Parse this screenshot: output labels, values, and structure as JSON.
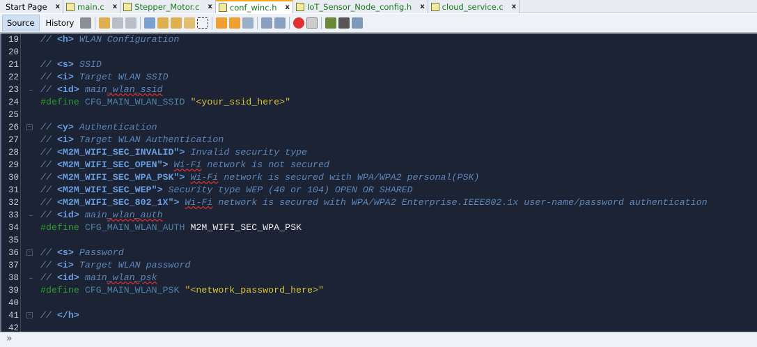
{
  "tabs": [
    {
      "label": "Start Page",
      "active": false
    },
    {
      "label": "main.c",
      "active": false
    },
    {
      "label": "Stepper_Motor.c",
      "active": false
    },
    {
      "label": "conf_winc.h",
      "active": true
    },
    {
      "label": "IoT_Sensor_Node_config.h",
      "active": false
    },
    {
      "label": "cloud_service.c",
      "active": false
    }
  ],
  "close_glyph": "x",
  "toolbar": {
    "source": "Source",
    "history": "History"
  },
  "editor": {
    "lines": [
      {
        "n": "19",
        "parts": [
          [
            "c",
            "// "
          ],
          [
            "t",
            "<h>"
          ],
          [
            "c",
            " WLAN Configuration"
          ]
        ]
      },
      {
        "n": "20",
        "parts": []
      },
      {
        "n": "21",
        "parts": [
          [
            "c",
            "// "
          ],
          [
            "t",
            "<s>"
          ],
          [
            "c",
            " SSID"
          ]
        ]
      },
      {
        "n": "22",
        "parts": [
          [
            "c",
            "// "
          ],
          [
            "t",
            "<i>"
          ],
          [
            "c",
            " Target WLAN SSID"
          ]
        ]
      },
      {
        "n": "23",
        "fold": "end",
        "parts": [
          [
            "c",
            "// "
          ],
          [
            "t",
            "<id>"
          ],
          [
            "c",
            " main"
          ],
          [
            "q",
            "_wlan_ssid"
          ]
        ]
      },
      {
        "n": "24",
        "parts": [
          [
            "k",
            "#define"
          ],
          [
            "i",
            " CFG_MAIN_WLAN_SSID "
          ],
          [
            "s",
            "\"<your_ssid_here>\""
          ]
        ]
      },
      {
        "n": "25",
        "parts": []
      },
      {
        "n": "26",
        "fold": "box",
        "parts": [
          [
            "c",
            "// "
          ],
          [
            "t",
            "<y>"
          ],
          [
            "c",
            " Authentication"
          ]
        ]
      },
      {
        "n": "27",
        "parts": [
          [
            "c",
            "// "
          ],
          [
            "t",
            "<i>"
          ],
          [
            "c",
            " Target WLAN Authentication"
          ]
        ]
      },
      {
        "n": "28",
        "parts": [
          [
            "c",
            "// "
          ],
          [
            "t",
            "<M2M_WIFI_SEC_INVALID\">"
          ],
          [
            "c",
            " Invalid security type"
          ]
        ]
      },
      {
        "n": "29",
        "parts": [
          [
            "c",
            "// "
          ],
          [
            "t",
            "<M2M_WIFI_SEC_OPEN\">"
          ],
          [
            "c",
            " "
          ],
          [
            "q",
            "Wi-Fi"
          ],
          [
            "c",
            " network is not secured"
          ]
        ]
      },
      {
        "n": "30",
        "parts": [
          [
            "c",
            "// "
          ],
          [
            "t",
            "<M2M_WIFI_SEC_WPA_PSK\">"
          ],
          [
            "c",
            " "
          ],
          [
            "q",
            "Wi-Fi"
          ],
          [
            "c",
            " network is secured with WPA/WPA2 personal(PSK)"
          ]
        ]
      },
      {
        "n": "31",
        "parts": [
          [
            "c",
            "// "
          ],
          [
            "t",
            "<M2M_WIFI_SEC_WEP\">"
          ],
          [
            "c",
            " Security type WEP (40 or 104) OPEN OR SHARED"
          ]
        ]
      },
      {
        "n": "32",
        "parts": [
          [
            "c",
            "// "
          ],
          [
            "t",
            "<M2M_WIFI_SEC_802_1X\">"
          ],
          [
            "c",
            " "
          ],
          [
            "q",
            "Wi-Fi"
          ],
          [
            "c",
            " network is secured with WPA/WPA2 Enterprise.IEEE802.1x user-name/password authentication"
          ]
        ]
      },
      {
        "n": "33",
        "fold": "end",
        "parts": [
          [
            "c",
            "// "
          ],
          [
            "t",
            "<id>"
          ],
          [
            "c",
            " main"
          ],
          [
            "q",
            "_wlan_auth"
          ]
        ]
      },
      {
        "n": "34",
        "parts": [
          [
            "k",
            "#define"
          ],
          [
            "i",
            " CFG_MAIN_WLAN_AUTH "
          ],
          [
            "w",
            "M2M_WIFI_SEC_WPA_PSK"
          ]
        ]
      },
      {
        "n": "35",
        "parts": []
      },
      {
        "n": "36",
        "fold": "box",
        "parts": [
          [
            "c",
            "// "
          ],
          [
            "t",
            "<s>"
          ],
          [
            "c",
            " Password"
          ]
        ]
      },
      {
        "n": "37",
        "parts": [
          [
            "c",
            "// "
          ],
          [
            "t",
            "<i>"
          ],
          [
            "c",
            " Target WLAN password"
          ]
        ]
      },
      {
        "n": "38",
        "fold": "end",
        "parts": [
          [
            "c",
            "// "
          ],
          [
            "t",
            "<id>"
          ],
          [
            "c",
            " main"
          ],
          [
            "q",
            "_wlan_psk"
          ]
        ]
      },
      {
        "n": "39",
        "parts": [
          [
            "k",
            "#define"
          ],
          [
            "i",
            " CFG_MAIN_WLAN_PSK "
          ],
          [
            "s",
            "\"<network_password_here>\""
          ]
        ]
      },
      {
        "n": "40",
        "parts": []
      },
      {
        "n": "41",
        "fold": "box",
        "parts": [
          [
            "c",
            "// "
          ],
          [
            "t",
            "</h>"
          ]
        ]
      },
      {
        "n": "42",
        "parts": []
      }
    ]
  },
  "bottom": {
    "expand_glyph": "»"
  }
}
